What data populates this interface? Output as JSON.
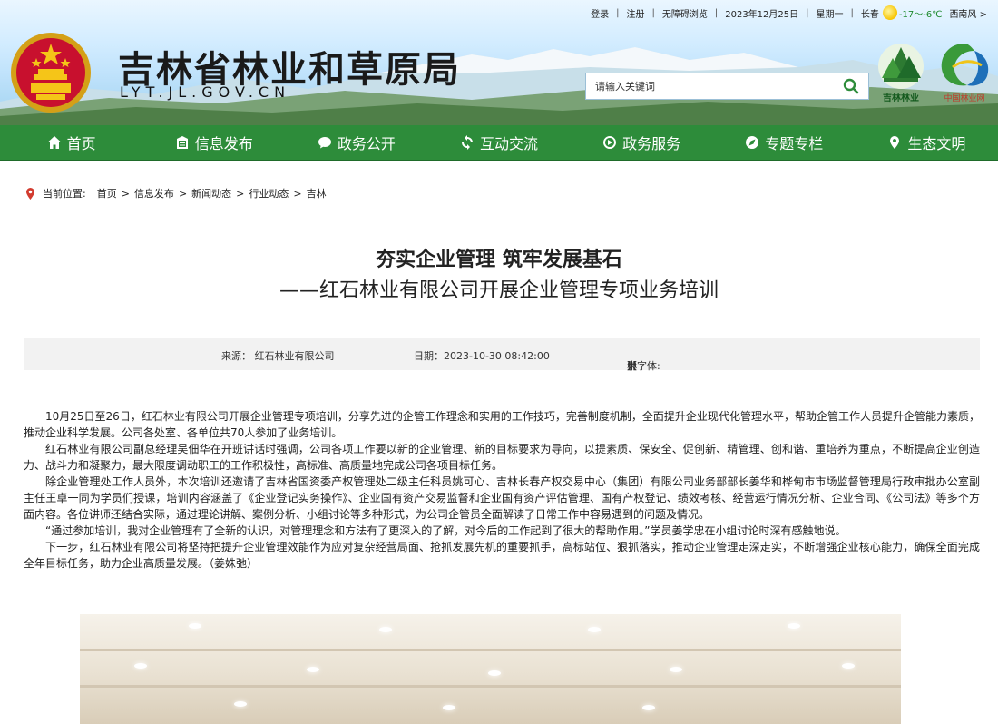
{
  "topbar": {
    "login": "登录",
    "register": "注册",
    "accessible": "无障碍浏览",
    "date": "2023年12月25日",
    "weekday": "星期一",
    "city": "长春",
    "temperature": "-17～-6℃",
    "wind": "西南风 >"
  },
  "header": {
    "title": "吉林省林业和草原局",
    "domain": "LYT.JL.GOV.CN",
    "search_placeholder": "请输入关键词",
    "logo1_label": "吉林林业",
    "logo2_label": "中国林业网"
  },
  "nav": {
    "items": [
      "首页",
      "信息发布",
      "政务公开",
      "互动交流",
      "政务服务",
      "专题专栏",
      "生态文明"
    ]
  },
  "breadcrumb": {
    "label": "当前位置:",
    "items": [
      "首页",
      "信息发布",
      "新闻动态",
      "行业动态",
      "吉林"
    ],
    "separator": ">"
  },
  "article": {
    "title_line1": "夯实企业管理 筑牢发展基石",
    "title_line2": "——红石林业有限公司开展企业管理专项业务培训",
    "source": "来源： 红石林业有限公司",
    "date": "日期：2023-10-30 08:42:00",
    "font_label": "【字体:",
    "font_large": "大",
    "font_medium": "中",
    "font_small": "小",
    "font_close": "】",
    "paragraphs": [
      "10月25日至26日，红石林业有限公司开展企业管理专项培训，分享先进的企管工作理念和实用的工作技巧，完善制度机制，全面提升企业现代化管理水平，帮助企管工作人员提升企管能力素质，推动企业科学发展。公司各处室、各单位共70人参加了业务培训。",
      "红石林业有限公司副总经理吴佃华在开班讲话时强调，公司各项工作要以新的企业管理、新的目标要求为导向，以提素质、保安全、促创新、精管理、创和谐、重培养为重点，不断提高企业创造力、战斗力和凝聚力，最大限度调动职工的工作积极性，高标准、高质量地完成公司各项目标任务。",
      "除企业管理处工作人员外，本次培训还邀请了吉林省国资委产权管理处二级主任科员姚可心、吉林长春产权交易中心（集团）有限公司业务部部长姜华和桦甸市市场监督管理局行政审批办公室副主任王卓一同为学员们授课，培训内容涵盖了《企业登记实务操作》、企业国有资产交易监督和企业国有资产评估管理、国有产权登记、绩效考核、经营运行情况分析、企业合同、《公司法》等多个方面内容。各位讲师还结合实际，通过理论讲解、案例分析、小组讨论等多种形式，为公司企管员全面解读了日常工作中容易遇到的问题及情况。",
      "“通过参加培训，我对企业管理有了全新的认识，对管理理念和方法有了更深入的了解，对今后的工作起到了很大的帮助作用。”学员姜学忠在小组讨论时深有感触地说。",
      "下一步，红石林业有限公司将坚持把提升企业管理效能作为应对复杂经营局面、抢抓发展先机的重要抓手，高标站位、狠抓落实，推动企业管理走深走实，不断增强企业核心能力，确保全面完成全年目标任务，助力企业高质量发展。（姜姝弛）"
    ]
  },
  "colors": {
    "nav_bg": "#2d8c3a",
    "search_icon": "#2d8c3a",
    "pin": "#d23b2f"
  }
}
